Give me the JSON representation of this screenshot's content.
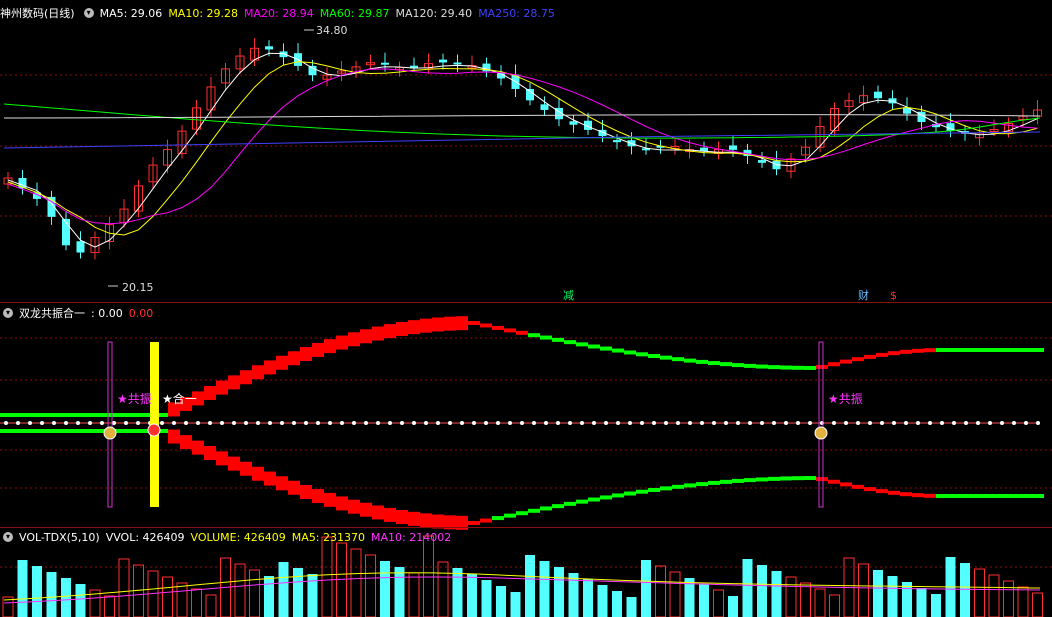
{
  "main_panel": {
    "title": "神州数码(日线)",
    "ma": [
      {
        "label": "MA5: 29.06",
        "color": "#ffffff"
      },
      {
        "label": "MA10: 29.28",
        "color": "#ffff00"
      },
      {
        "label": "MA20: 28.94",
        "color": "#ff00ff"
      },
      {
        "label": "MA60: 29.87",
        "color": "#00ff00"
      },
      {
        "label": "MA120: 29.40",
        "color": "#dddddd"
      },
      {
        "label": "MA250: 28.75",
        "color": "#4040ff"
      }
    ],
    "high_label": "34.80",
    "low_label": "20.15",
    "markers": [
      {
        "text": "减",
        "color": "#00ff66"
      },
      {
        "text": "财",
        "color": "#66bbff"
      },
      {
        "text": "$",
        "color": "#ff3030"
      }
    ]
  },
  "indicator_panel": {
    "title": "双龙共振合一",
    "value1": ": 0.00",
    "value2": "0.00",
    "value1_color": "#ffffff",
    "value2_color": "#ff3030",
    "labels": {
      "resonance_1": "★共振",
      "merge": "★合一",
      "resonance_2": "★共振"
    }
  },
  "volume_panel": {
    "title": "VOL-TDX(5,10)",
    "vvol": "VVOL: 426409",
    "volume": "VOLUME: 426409",
    "ma5": "MA5: 231370",
    "ma10": "MA10: 214002"
  },
  "colors": {
    "up": "#ff3030",
    "down": "#54ffff",
    "grid": "#8a1010",
    "dragon_up": "#ff0000",
    "dragon_down": "#00ff00",
    "signal_bar": "#ffff00",
    "signal_line": "#cc33cc"
  }
}
